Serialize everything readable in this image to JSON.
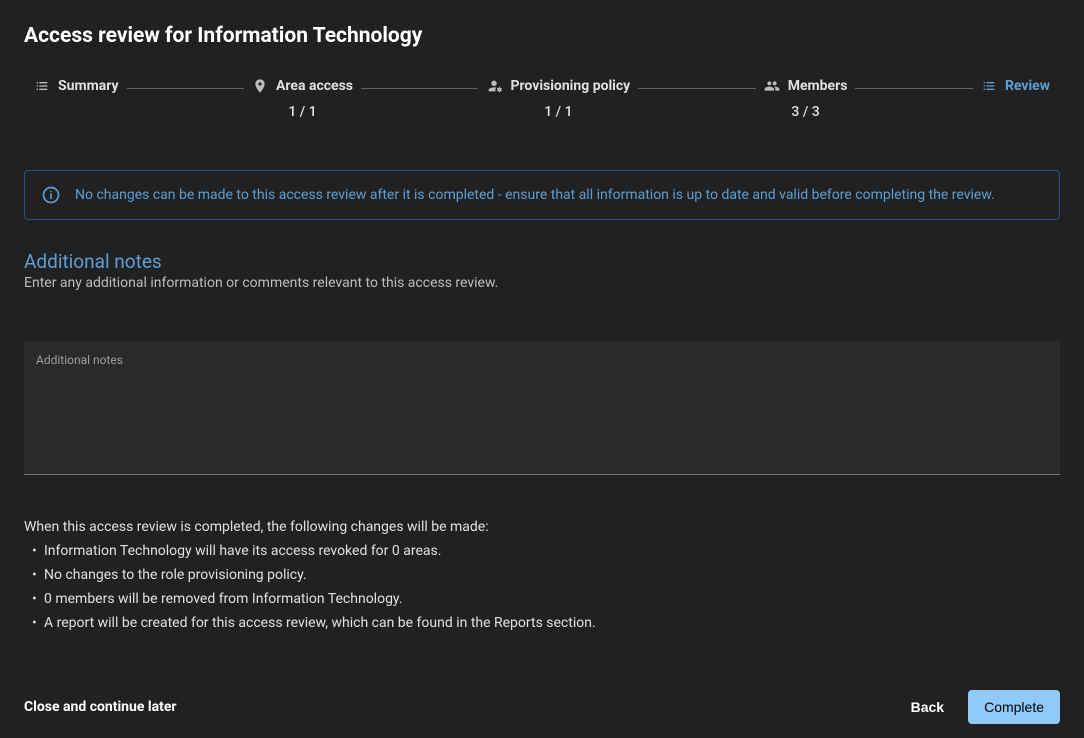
{
  "title": "Access review for Information Technology",
  "stepper": {
    "summary": {
      "label": "Summary"
    },
    "area_access": {
      "label": "Area access",
      "count": "1 / 1"
    },
    "provisioning": {
      "label": "Provisioning policy",
      "count": "1 / 1"
    },
    "members": {
      "label": "Members",
      "count": "3 / 3"
    },
    "review": {
      "label": "Review"
    }
  },
  "info_banner": "No changes can be made to this access review after it is completed - ensure that all information is up to date and valid before completing the review.",
  "notes": {
    "title": "Additional notes",
    "subtitle": "Enter any additional information or comments relevant to this access review.",
    "placeholder": "Additional notes"
  },
  "changes": {
    "intro": "When this access review is completed, the following changes will be made:",
    "items": [
      "Information Technology will have its access revoked for 0 areas.",
      "No changes to the role provisioning policy.",
      "0 members will be removed from Information Technology.",
      "A report will be created for this access review, which can be found in the Reports section."
    ]
  },
  "footer": {
    "close": "Close and continue later",
    "back": "Back",
    "complete": "Complete"
  }
}
